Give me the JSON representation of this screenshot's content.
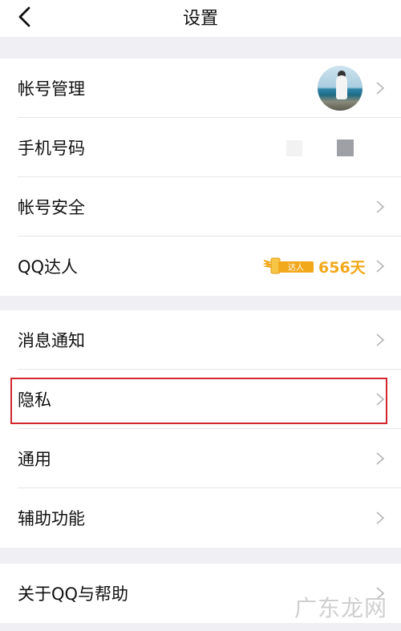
{
  "header": {
    "title": "设置"
  },
  "group1": {
    "items": [
      {
        "label": "帐号管理"
      },
      {
        "label": "手机号码"
      },
      {
        "label": "帐号安全"
      },
      {
        "label": "QQ达人",
        "badge_text": "达人",
        "days": "656天"
      }
    ]
  },
  "group2": {
    "items": [
      {
        "label": "消息通知"
      },
      {
        "label": "隐私"
      },
      {
        "label": "通用"
      },
      {
        "label": "辅助功能"
      }
    ]
  },
  "group3": {
    "items": [
      {
        "label": "关于QQ与帮助"
      }
    ]
  },
  "watermark": "广东龙网",
  "colors": {
    "background": "#efeff4",
    "highlight_border": "#d2262f",
    "badge": "#f2a81b"
  },
  "icons": [
    "back-arrow-icon",
    "chevron-right-icon",
    "qq-talent-badge-icon"
  ]
}
